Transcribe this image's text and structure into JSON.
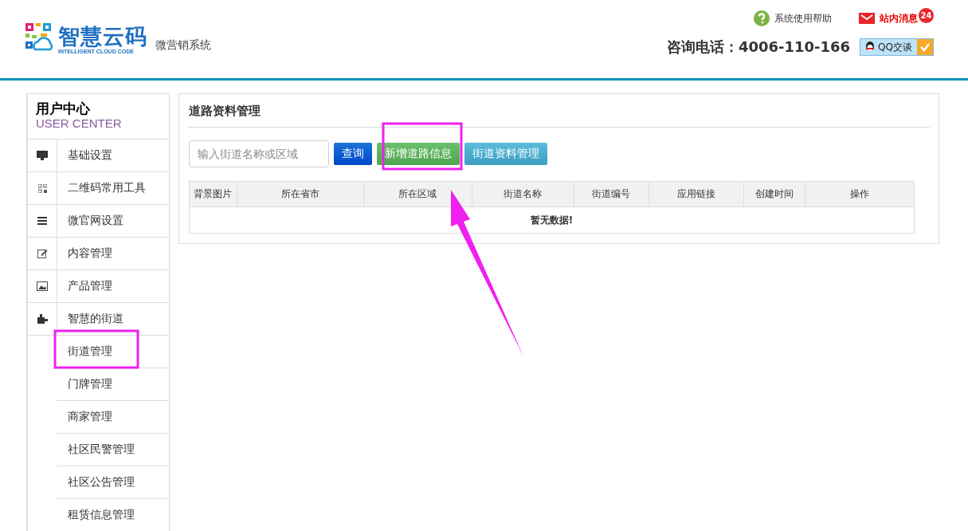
{
  "header": {
    "logo_title": "智慧云码",
    "logo_subtitle": "INTELLIGENT CLOUD CODE",
    "system_name": "微营销系统",
    "help_link": "系统使用帮助",
    "messages_link": "站内消息",
    "messages_count": "24",
    "phone": "咨询电话：4006-110-166",
    "qq_button": "QQ交谈"
  },
  "sidebar": {
    "title": "用户中心",
    "subtitle": "USER CENTER",
    "items": [
      {
        "label": "基础设置"
      },
      {
        "label": "二维码常用工具"
      },
      {
        "label": "微官网设置"
      },
      {
        "label": "内容管理"
      },
      {
        "label": "产品管理"
      },
      {
        "label": "智慧的街道",
        "children": [
          {
            "label": "街道管理"
          },
          {
            "label": "门牌管理"
          },
          {
            "label": "商家管理"
          },
          {
            "label": "社区民警管理"
          },
          {
            "label": "社区公告管理"
          },
          {
            "label": "租赁信息管理"
          }
        ]
      }
    ]
  },
  "panel": {
    "title": "道路资料管理",
    "search": {
      "placeholder": "输入街道名称或区域"
    },
    "buttons": [
      {
        "label": "查询",
        "kind": "primary"
      },
      {
        "label": "新增道路信息",
        "kind": "success"
      },
      {
        "label": "街道资料管理",
        "kind": "info"
      }
    ],
    "table": {
      "columns": [
        "背景图片",
        "所在省市",
        "所在区域",
        "街道名称",
        "街道编号",
        "应用链接",
        "创建时间",
        "操作"
      ],
      "empty_message": "暂无数据!"
    }
  }
}
